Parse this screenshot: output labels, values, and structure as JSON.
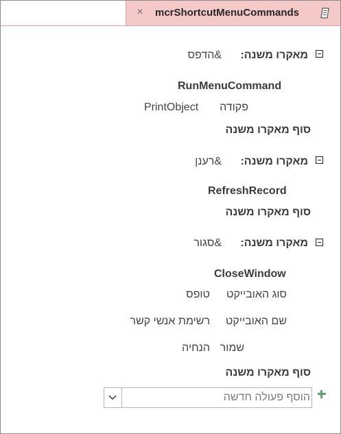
{
  "tab": {
    "title": "mcrShortcutMenuCommands",
    "close_glyph": "×",
    "icon": "macro-document-icon"
  },
  "submacros": [
    {
      "header_label": "מאקרו משנה:",
      "name": "&הדפס",
      "action": "RunMenuCommand",
      "arguments": [
        {
          "label": "פקודה",
          "value": "PrintObject"
        }
      ],
      "end_label": "סוף מאקרו משנה"
    },
    {
      "header_label": "מאקרו משנה:",
      "name": "&רענן",
      "action": "RefreshRecord",
      "arguments": [],
      "end_label": "סוף מאקרו משנה"
    },
    {
      "header_label": "מאקרו משנה:",
      "name": "&סגור",
      "action": "CloseWindow",
      "arguments": [
        {
          "label": "סוג האובייקט",
          "value": "טופס"
        },
        {
          "label": "שם האובייקט",
          "value": "רשימת אנשי קשר"
        },
        {
          "label": "שמור",
          "value": "הנחיה"
        }
      ],
      "end_label": "סוף מאקרו משנה"
    }
  ],
  "add_action": {
    "placeholder": "הוסף פעולה חדשה",
    "value": ""
  },
  "colors": {
    "tab_background": "#f6c9c9",
    "add_icon": "#5aa364",
    "text": "#444444"
  }
}
